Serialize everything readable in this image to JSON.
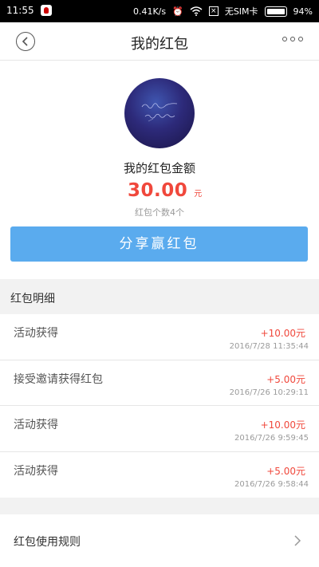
{
  "status_bar": {
    "time": "11:55",
    "network_speed": "0.41K/s",
    "sim_status": "无SIM卡",
    "battery_percent": "94%",
    "battery_level": 0.94
  },
  "nav": {
    "title": "我的红包"
  },
  "summary": {
    "amount_label": "我的红包金额",
    "amount_value": "30.00",
    "amount_unit": "元",
    "count_text": "红包个数4个",
    "share_button": "分享赢红包"
  },
  "details": {
    "section_title": "红包明细",
    "records": [
      {
        "title": "活动获得",
        "amount": "+10.00元",
        "time": "2016/7/28 11:35:44"
      },
      {
        "title": "接受邀请获得红包",
        "amount": "+5.00元",
        "time": "2016/7/26 10:29:11"
      },
      {
        "title": "活动获得",
        "amount": "+10.00元",
        "time": "2016/7/26 9:59:45"
      },
      {
        "title": "活动获得",
        "amount": "+5.00元",
        "time": "2016/7/26 9:58:44"
      }
    ]
  },
  "rules": {
    "label": "红包使用规则"
  },
  "colors": {
    "accent_red": "#f0483c",
    "button_blue": "#5aabee"
  }
}
